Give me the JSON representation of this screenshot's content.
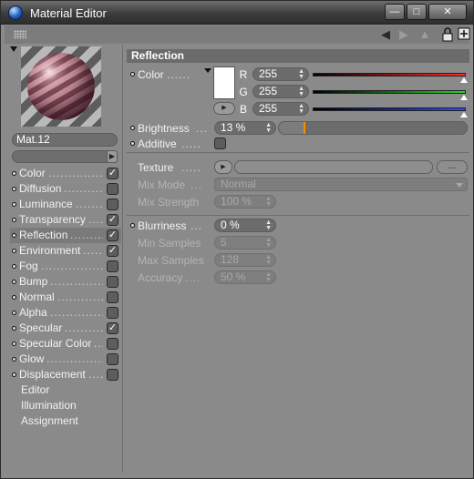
{
  "window": {
    "title": "Material Editor",
    "min_label": "—",
    "max_label": "□",
    "close_label": "✕"
  },
  "toolbar": {
    "back_glyph": "◀",
    "forward_glyph": "▶",
    "up_glyph": "▲",
    "lock_glyph": "🔒",
    "new_glyph": "⊞"
  },
  "material": {
    "name": "Mat.12"
  },
  "channels": [
    {
      "label": "Color",
      "checked": true
    },
    {
      "label": "Diffusion",
      "checked": false
    },
    {
      "label": "Luminance",
      "checked": false
    },
    {
      "label": "Transparency",
      "checked": true
    },
    {
      "label": "Reflection",
      "checked": true,
      "active": true
    },
    {
      "label": "Environment",
      "checked": true
    },
    {
      "label": "Fog",
      "checked": false
    },
    {
      "label": "Bump",
      "checked": false
    },
    {
      "label": "Normal",
      "checked": false
    },
    {
      "label": "Alpha",
      "checked": false
    },
    {
      "label": "Specular",
      "checked": true
    },
    {
      "label": "Specular Color",
      "checked": false
    },
    {
      "label": "Glow",
      "checked": false
    },
    {
      "label": "Displacement",
      "checked": false
    }
  ],
  "extra_items": [
    "Editor",
    "Illumination",
    "Assignment"
  ],
  "checkmark": "✓",
  "reflection": {
    "header": "Reflection",
    "color_label": "Color",
    "r_label": "R",
    "g_label": "G",
    "b_label": "B",
    "r_value": "255",
    "g_value": "255",
    "b_value": "255",
    "brightness_label": "Brightness",
    "brightness_value": "13 %",
    "brightness_level": 0.13,
    "additive_label": "Additive",
    "texture_label": "Texture",
    "texture_button": "...",
    "mix_mode_label": "Mix Mode",
    "mix_mode_value": "Normal",
    "mix_strength_label": "Mix Strength",
    "mix_strength_value": "100 %",
    "blurriness_label": "Blurriness",
    "blurriness_value": "0 %",
    "min_samples_label": "Min Samples",
    "min_samples_value": "5",
    "max_samples_label": "Max Samples",
    "max_samples_value": "128",
    "accuracy_label": "Accuracy",
    "accuracy_value": "50 %"
  },
  "colors": {
    "red_bar": "#ff2a2a",
    "green_bar": "#27d227",
    "blue_bar": "#2a4dff",
    "brightness_marker": "#ff8a00"
  }
}
